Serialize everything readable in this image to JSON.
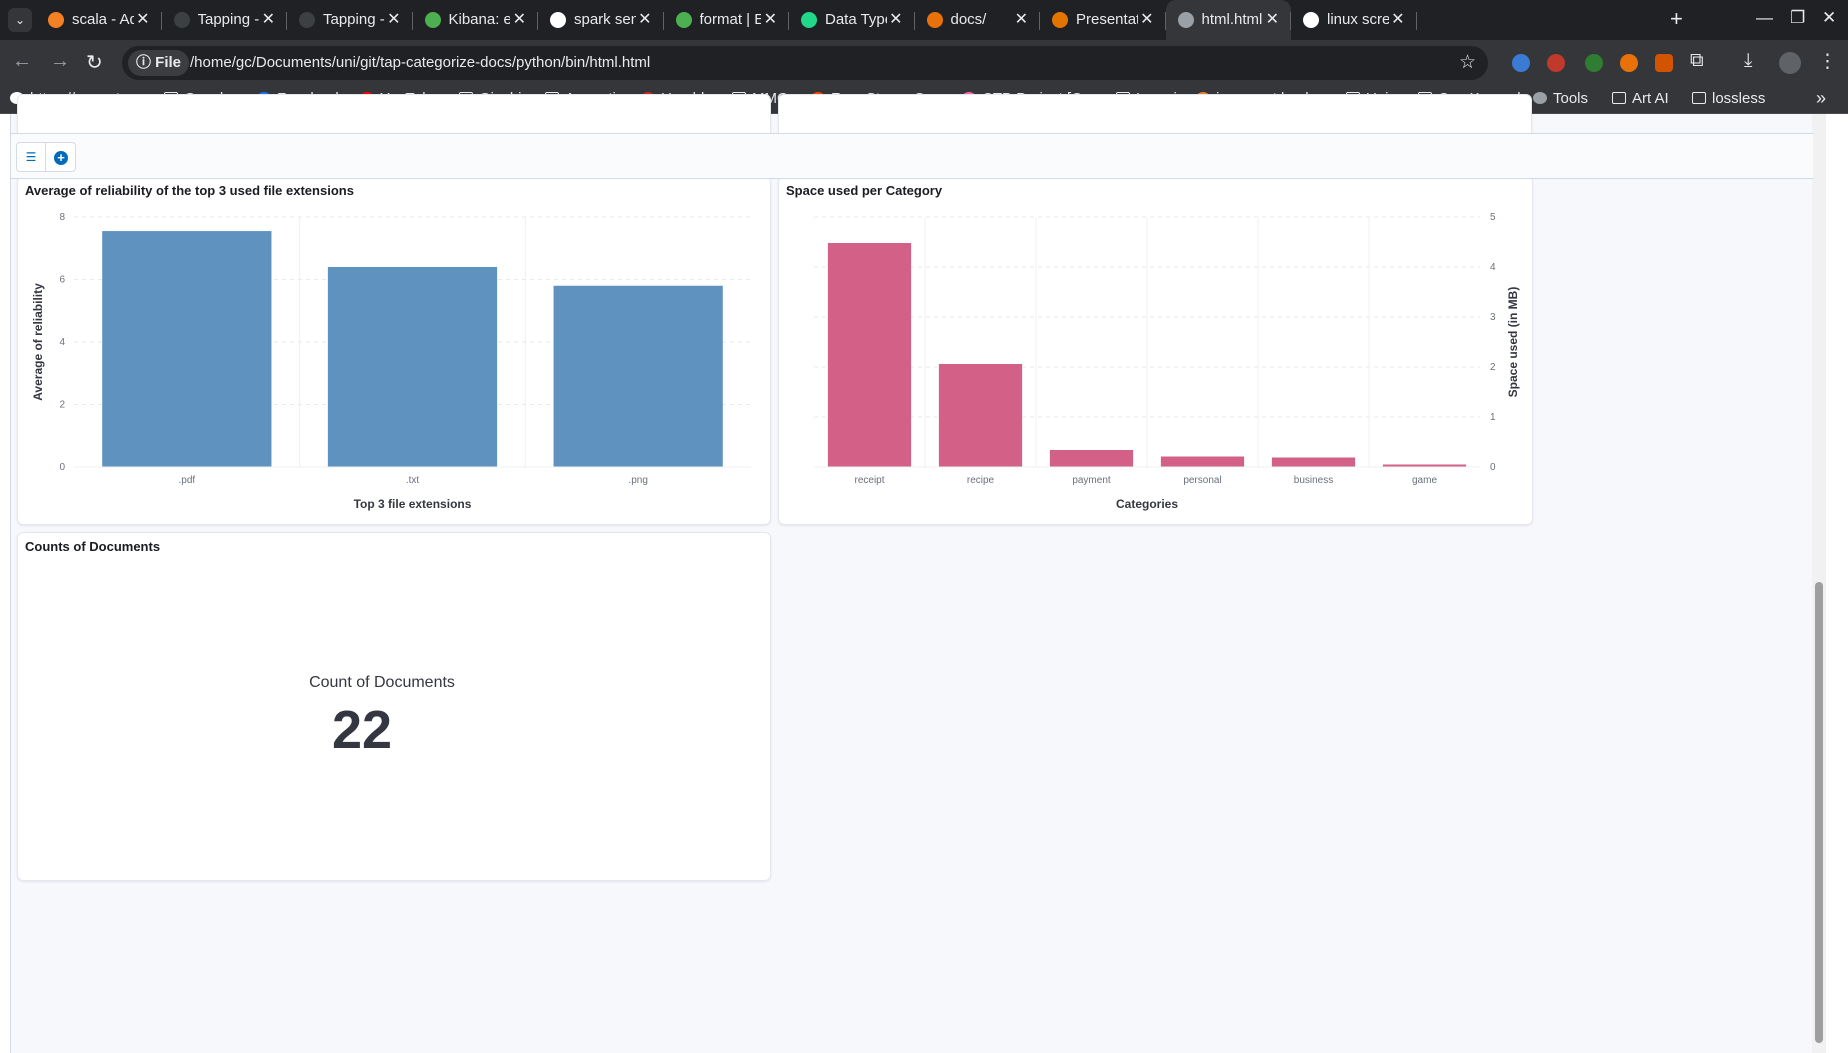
{
  "browser": {
    "tabs": [
      {
        "title": "scala - Addi",
        "icon_color": "#f48024"
      },
      {
        "title": "Tapping - El",
        "icon_color": "#3c4043"
      },
      {
        "title": "Tapping - El",
        "icon_color": "#3c4043"
      },
      {
        "title": "Kibana: exp",
        "icon_color": "#4caf50"
      },
      {
        "title": "spark send",
        "icon_color": "#ffffff"
      },
      {
        "title": "format | Ela",
        "icon_color": "#4caf50"
      },
      {
        "title": "Data Type",
        "icon_color": "#21d789"
      },
      {
        "title": "docs/",
        "icon_color": "#e8710a"
      },
      {
        "title": "Presentatio",
        "icon_color": "#e37400"
      },
      {
        "title": "html.html",
        "icon_color": "#9aa0a6"
      },
      {
        "title": "linux scree",
        "icon_color": "#ffffff"
      }
    ],
    "active_tab": "html.html",
    "address": {
      "chip": "File",
      "url": "/home/gc/Documents/uni/git/tap-categorize-docs/python/bin/html.html"
    },
    "bookmarks": [
      {
        "label": "https://amzn.t...",
        "icon": "amazon-icon",
        "color": "#ffffff"
      },
      {
        "label": "Gensho",
        "icon": "folder-icon"
      },
      {
        "label": "Facebook",
        "icon": "facebook-icon",
        "color": "#1877f2"
      },
      {
        "label": "YouTube",
        "icon": "youtube-icon",
        "color": "#ff0000"
      },
      {
        "label": "Giochi",
        "icon": "folder-icon"
      },
      {
        "label": "Appunti",
        "icon": "folder-icon"
      },
      {
        "label": "Humble",
        "icon": "humble-icon",
        "color": "#cc2929"
      },
      {
        "label": "MMO",
        "icon": "folder-icon"
      },
      {
        "label": "Free Steam Ga...",
        "icon": "reddit-icon",
        "color": "#ff4500"
      },
      {
        "label": "CTB Project [C...",
        "icon": "osu-icon",
        "color": "#ff66aa"
      },
      {
        "label": "Lavori",
        "icon": "folder-icon"
      },
      {
        "label": "java - set back...",
        "icon": "stackoverflow-icon",
        "color": "#f48024"
      },
      {
        "label": "Uni",
        "icon": "folder-icon"
      },
      {
        "label": "Osu Keypad",
        "icon": "folder-icon"
      },
      {
        "label": "Tools",
        "icon": "globe-icon",
        "color": "#9aa0a6"
      },
      {
        "label": "Art AI",
        "icon": "folder-icon"
      },
      {
        "label": "lossless",
        "icon": "folder-icon"
      }
    ]
  },
  "dashboard": {
    "filter_button_icon": "filter-icon",
    "add_button_icon": "plus-icon"
  },
  "panels": {
    "reliability": {
      "title": "Average of reliability of the top 3 used file extensions"
    },
    "space": {
      "title": "Space used per Category"
    },
    "counts": {
      "title": "Counts of Documents",
      "metric_label": "Count of Documents",
      "metric_value": "22"
    }
  },
  "chart_data": [
    {
      "type": "bar",
      "title": "Average of reliability of the top 3 used file extensions",
      "categories": [
        ".pdf",
        ".txt",
        ".png"
      ],
      "values": [
        7.55,
        6.4,
        5.8
      ],
      "xlabel": "Top 3 file extensions",
      "ylabel": "Average of reliability",
      "ylim": [
        0,
        8
      ],
      "yticks": [
        0,
        2,
        4,
        6,
        8
      ],
      "color": "#6092c0",
      "grid": true,
      "y_axis_side": "left"
    },
    {
      "type": "bar",
      "title": "Space used per Category",
      "categories": [
        "receipt",
        "recipe",
        "payment",
        "personal",
        "business",
        "game"
      ],
      "values": [
        4.48,
        2.06,
        0.34,
        0.21,
        0.19,
        0.05
      ],
      "xlabel": "Categories",
      "ylabel": "Space used (in MB)",
      "ylim": [
        0,
        5
      ],
      "yticks": [
        0,
        1,
        2,
        3,
        4,
        5
      ],
      "color": "#d36086",
      "grid": true,
      "y_axis_side": "right"
    }
  ]
}
